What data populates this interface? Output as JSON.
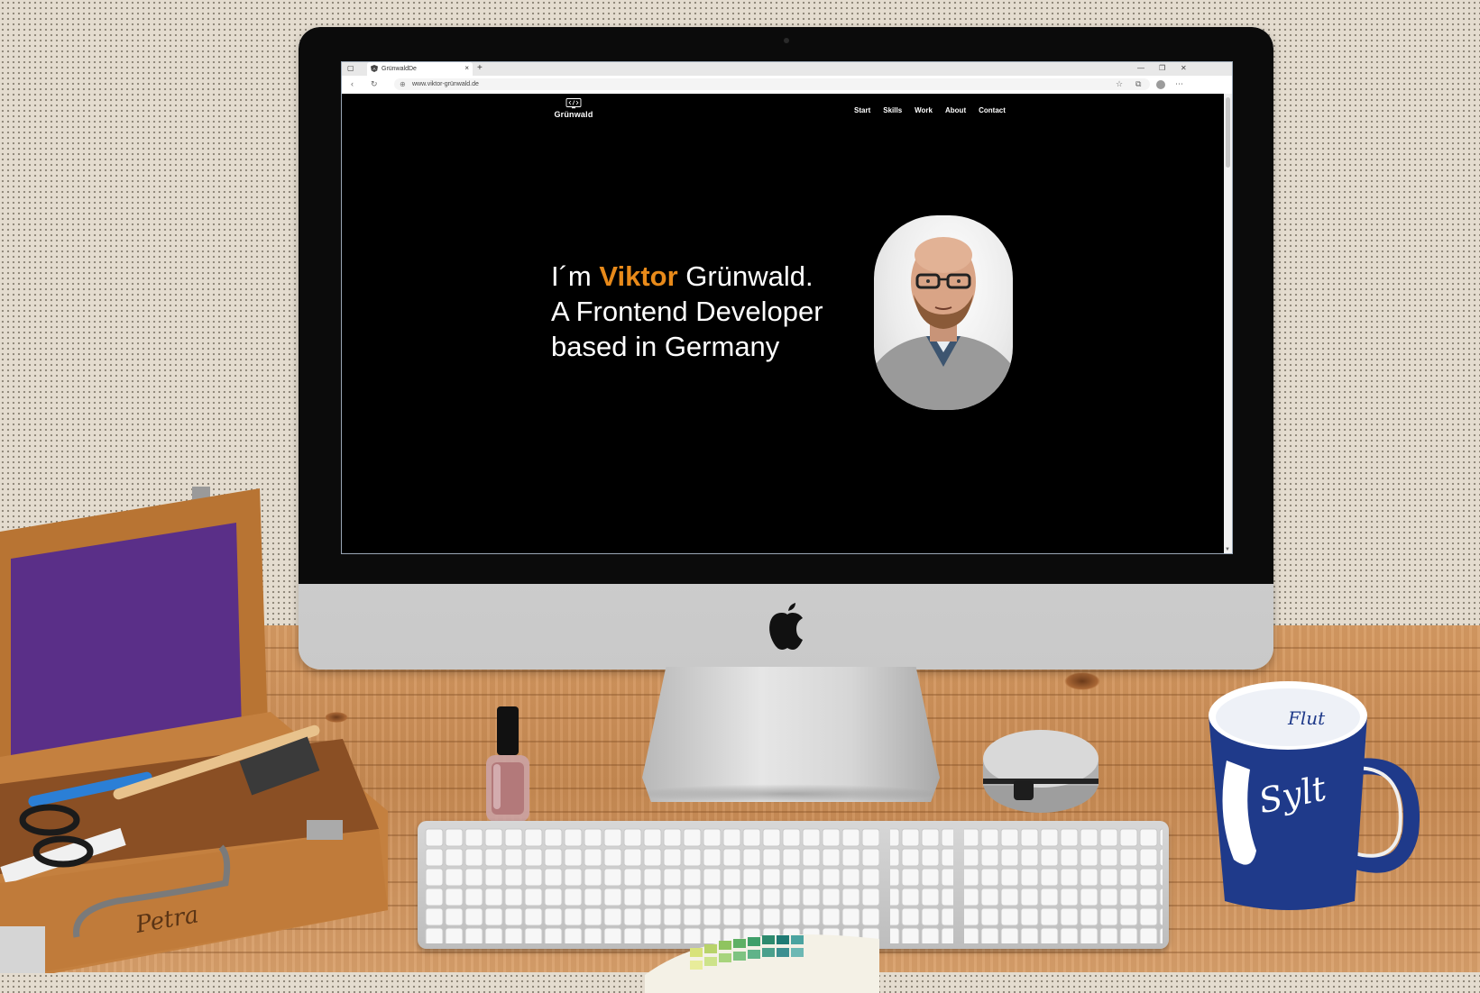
{
  "browser": {
    "tab_title": "GrünwaldDe",
    "tab_close": "×",
    "new_tab": "+",
    "url": "www.viktor-grünwald.de",
    "window_controls": {
      "minimize": "—",
      "maximize": "❐",
      "close": "✕"
    }
  },
  "site": {
    "logo_text": "Grünwald",
    "nav": [
      "Start",
      "Skills",
      "Work",
      "About",
      "Contact"
    ],
    "hero": {
      "line1_prefix": "I´m ",
      "line1_name_accent": "Viktor",
      "line1_suffix": " Grünwald.",
      "line2": "A Frontend Developer",
      "line3": "based in Germany"
    },
    "accent_color": "#e88a1a",
    "background_color": "#000000",
    "text_color": "#ffffff"
  },
  "desk": {
    "toolbox_label": "Petra",
    "mug_text_top": "Flut",
    "mug_text_side": "Sylt"
  },
  "icons": {
    "back": "back-arrow-icon",
    "refresh": "refresh-icon",
    "site_info": "globe-icon",
    "favorites": "star-icon",
    "collections": "collections-icon",
    "profile": "profile-icon",
    "more": "more-icon"
  }
}
